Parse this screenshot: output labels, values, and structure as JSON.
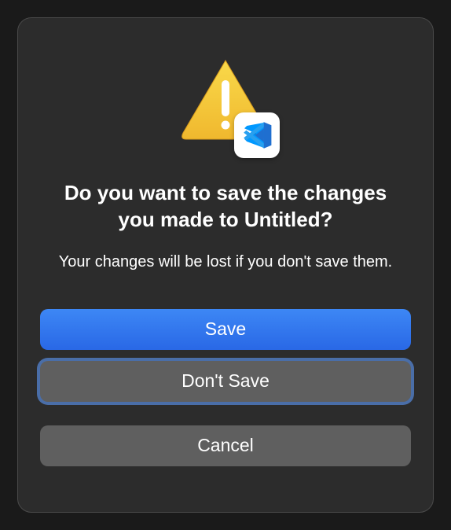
{
  "dialog": {
    "title": "Do you want to save the changes you made to Untitled?",
    "message": "Your changes will be lost if you don't save them.",
    "buttons": {
      "save": "Save",
      "dontSave": "Don't Save",
      "cancel": "Cancel"
    }
  }
}
